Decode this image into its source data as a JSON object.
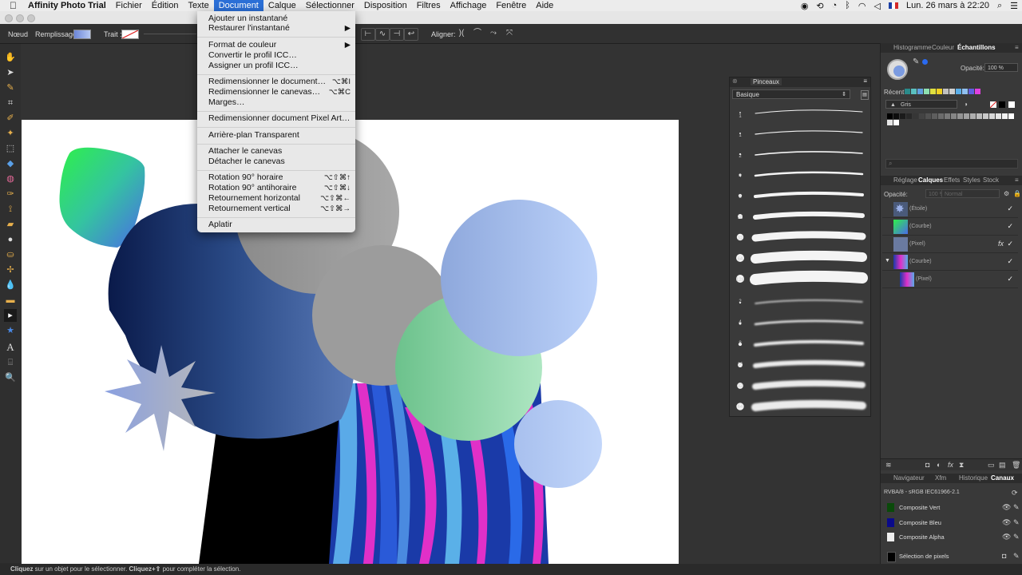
{
  "menubar": {
    "app_name": "Affinity Photo Trial",
    "items": [
      "Fichier",
      "Édition",
      "Texte",
      "Document",
      "Calque",
      "Sélectionner",
      "Disposition",
      "Filtres",
      "Affichage",
      "Fenêtre",
      "Aide"
    ],
    "active": "Document",
    "clock": "Lun. 26 mars à  22:20"
  },
  "context_toolbar": {
    "mode_label": "Nœud",
    "fill_label": "Remplissage :",
    "stroke_label": "Trait :",
    "align_label": "Aligner:",
    "fill_color": "#8aa0e0"
  },
  "document_menu": {
    "items": [
      {
        "label": "Ajouter un instantané",
        "shortcut": ""
      },
      {
        "label": "Restaurer l'instantané",
        "shortcut": "▶"
      },
      {
        "label": "Format de couleur",
        "shortcut": "▶"
      },
      {
        "label": "Convertir le profil ICC…",
        "shortcut": ""
      },
      {
        "label": "Assigner un profil ICC…",
        "shortcut": ""
      },
      {
        "label": "Redimensionner le document…",
        "shortcut": "⌥⌘I"
      },
      {
        "label": "Redimensionner le canevas…",
        "shortcut": "⌥⌘C"
      },
      {
        "label": "Marges…",
        "shortcut": ""
      },
      {
        "label": "Redimensionner document Pixel Art…",
        "shortcut": ""
      },
      {
        "label": "Arrière-plan Transparent",
        "shortcut": ""
      },
      {
        "label": "Attacher le canevas",
        "shortcut": ""
      },
      {
        "label": "Détacher le canevas",
        "shortcut": ""
      },
      {
        "label": "Rotation 90° horaire",
        "shortcut": "⌥⇧⌘↑"
      },
      {
        "label": "Rotation 90° antihoraire",
        "shortcut": "⌥⇧⌘↓"
      },
      {
        "label": "Retournement horizontal",
        "shortcut": "⌥⇧⌘←"
      },
      {
        "label": "Retournement vertical",
        "shortcut": "⌥⇧⌘→"
      },
      {
        "label": "Aplatir",
        "shortcut": ""
      }
    ]
  },
  "brushes_panel": {
    "title": "Pinceaux",
    "category": "Basique",
    "sizes_group1": [
      "1",
      "1",
      "2",
      "4",
      "8",
      "16",
      "32",
      "64",
      "128"
    ],
    "sizes_group2": [
      "2",
      "4",
      "8",
      "16",
      "32",
      "64",
      "128"
    ]
  },
  "swatches_panel": {
    "tabs": [
      "Histogramme",
      "Couleur",
      "Échantillons"
    ],
    "active_tab": "Échantillons",
    "opacity_label": "Opacité:",
    "opacity_value": "100 %",
    "recent_label": "Récent:",
    "palette_name": "Gris"
  },
  "layers_panel": {
    "tabs": [
      "Réglage",
      "Calques",
      "Effets",
      "Styles",
      "Stock"
    ],
    "active_tab": "Calques",
    "opacity_label": "Opacité:",
    "opacity_value": "100 %",
    "blend_mode": "Normal",
    "layers": [
      {
        "name": "(Étoile)"
      },
      {
        "name": "(Courbe)"
      },
      {
        "name": "(Pixel)"
      },
      {
        "name": "(Courbe)"
      },
      {
        "name": "(Pixel)"
      }
    ]
  },
  "channels_panel": {
    "tabs": [
      "Navigateur",
      "Xfm",
      "Historique",
      "Canaux"
    ],
    "active_tab": "Canaux",
    "profile": "RVBA/8 - sRGB IEC61966-2.1",
    "channels": [
      "Composite Vert",
      "Composite Bleu",
      "Composite Alpha",
      "Sélection de pixels"
    ]
  },
  "status": {
    "bold1": "Cliquez",
    "text1": " sur un objet pour le sélectionner. ",
    "bold2": "Cliquez+⇧",
    "text2": " pour compléter la sélection."
  }
}
